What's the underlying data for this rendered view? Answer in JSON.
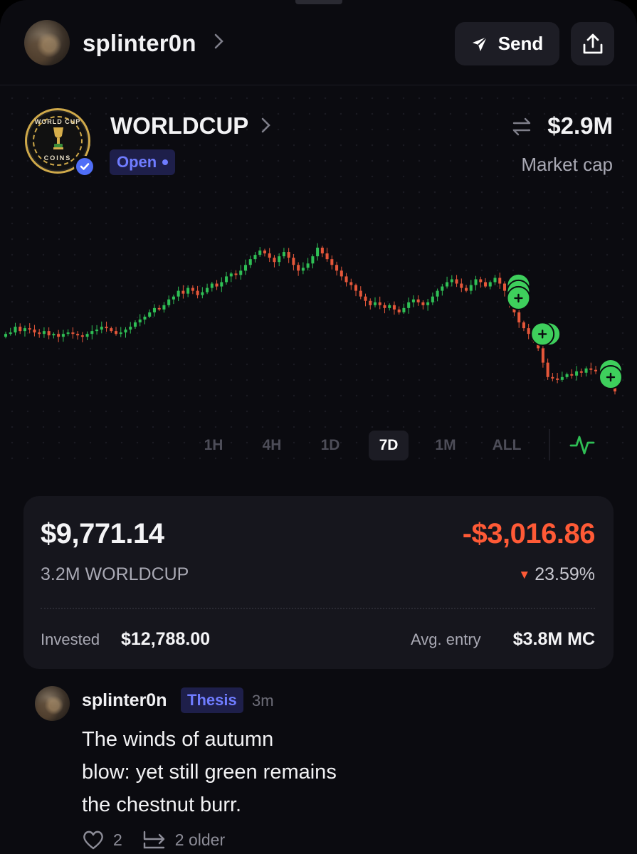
{
  "header": {
    "username": "splinter0n",
    "send_label": "Send"
  },
  "token": {
    "name": "WORLDCUP",
    "status": "Open",
    "market_cap": "$2.9M",
    "market_cap_label": "Market cap",
    "coin_text_top": "WORLD CUP",
    "coin_text_bottom": "COINS"
  },
  "timeframes": [
    "1H",
    "4H",
    "1D",
    "7D",
    "1M",
    "ALL"
  ],
  "active_timeframe": "7D",
  "position": {
    "value": "$9,771.14",
    "pnl": "-$3,016.86",
    "holding": "3.2M WORLDCUP",
    "pnl_pct": "23.59%",
    "invested_label": "Invested",
    "invested_value": "$12,788.00",
    "entry_label": "Avg. entry",
    "entry_value": "$3.8M MC"
  },
  "comment": {
    "username": "splinter0n",
    "tag": "Thesis",
    "time": "3m",
    "text": "The winds of autumn\nblow: yet still green remains\nthe chestnut burr.",
    "likes": "2",
    "older_label": "2 older"
  },
  "colors": {
    "up": "#2fbf55",
    "down": "#e5573a",
    "buy_marker": "#3ecf5c",
    "accent": "#6f7cff",
    "negative": "#ff5a36"
  },
  "chart_data": {
    "type": "candlestick",
    "x_unit": "candle index",
    "y_unit": "relative price",
    "close": [
      40,
      41,
      45,
      42,
      44,
      43,
      41,
      40,
      42,
      39,
      40,
      38,
      40,
      41,
      40,
      39,
      38,
      40,
      42,
      43,
      45,
      44,
      42,
      40,
      41,
      43,
      45,
      48,
      50,
      52,
      55,
      58,
      57,
      60,
      64,
      66,
      70,
      68,
      72,
      70,
      67,
      69,
      72,
      75,
      73,
      76,
      80,
      82,
      81,
      84,
      88,
      92,
      95,
      98,
      96,
      93,
      90,
      94,
      97,
      93,
      88,
      84,
      86,
      89,
      94,
      100,
      96,
      92,
      88,
      84,
      80,
      76,
      74,
      70,
      66,
      63,
      60,
      62,
      60,
      58,
      60,
      57,
      55,
      58,
      62,
      64,
      62,
      60,
      62,
      66,
      70,
      73,
      76,
      78,
      75,
      72,
      70,
      74,
      78,
      76,
      73,
      76,
      79,
      75,
      70,
      62,
      55,
      48,
      44,
      40,
      35,
      30,
      20,
      10,
      9,
      8,
      10,
      12,
      11,
      14,
      13,
      16,
      15,
      14,
      12,
      10,
      6,
      0
    ],
    "buy_markers_at_index": [
      106,
      111,
      127
    ]
  }
}
